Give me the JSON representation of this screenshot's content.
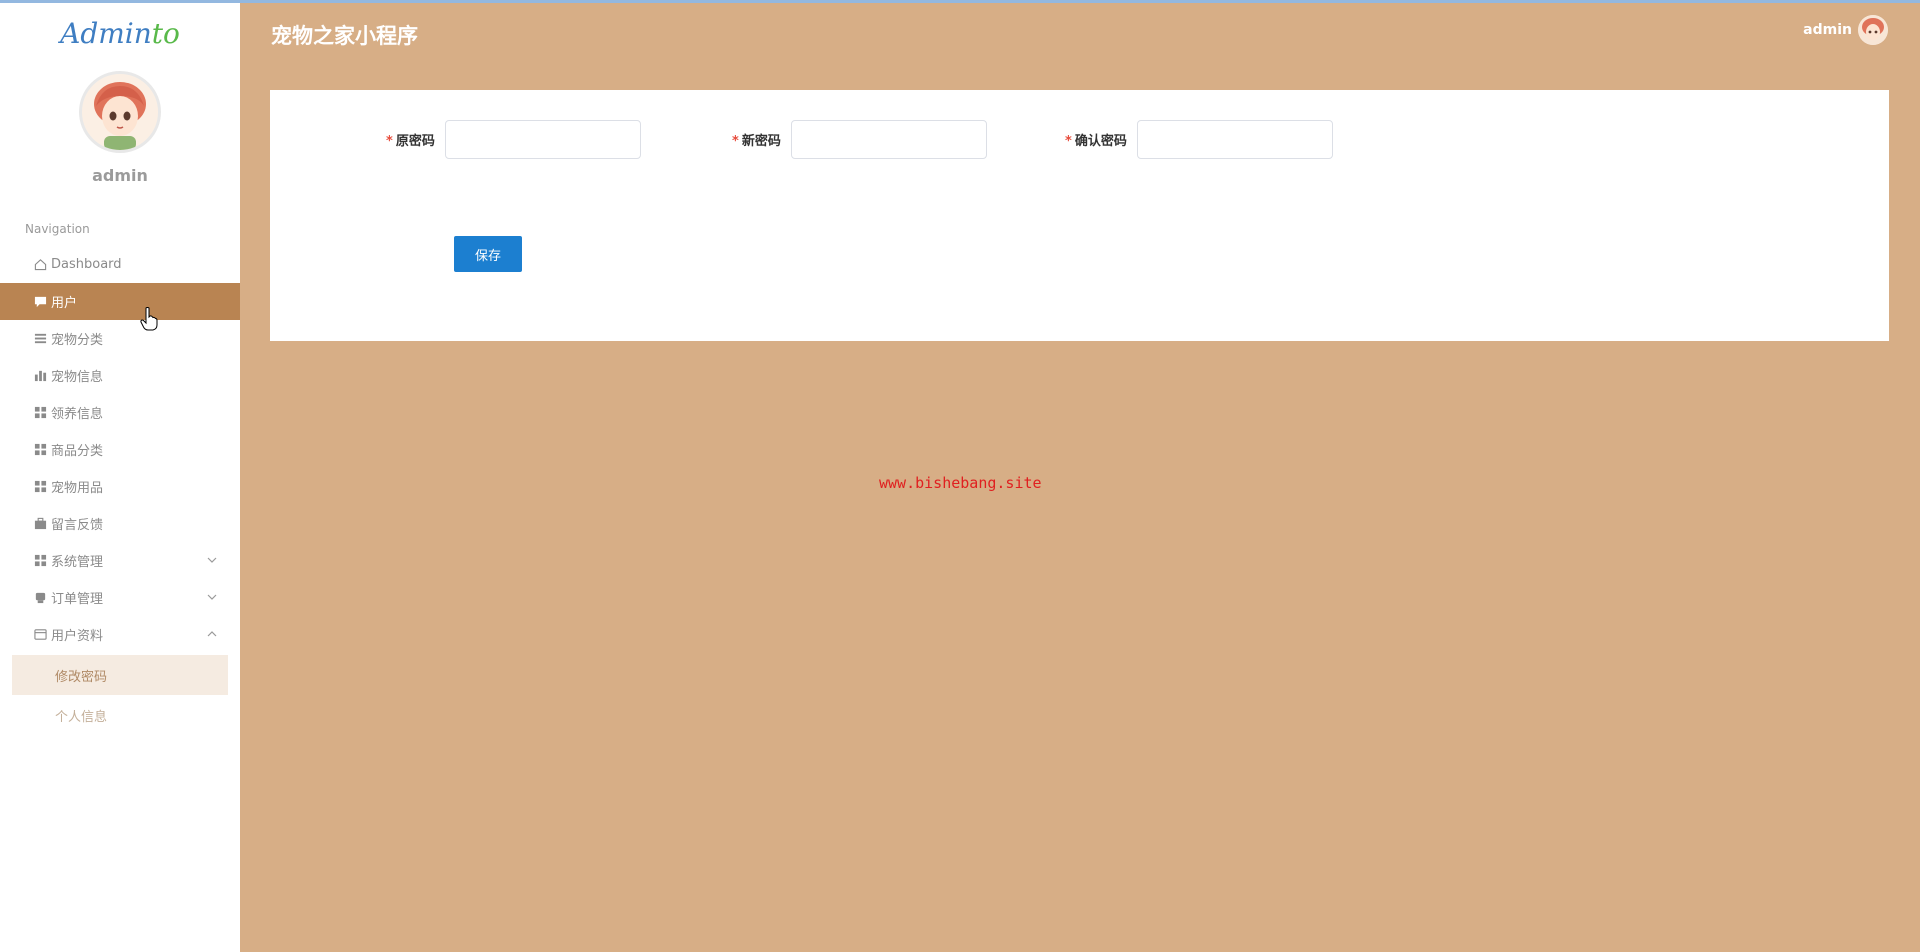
{
  "colors": {
    "accent": "#b98452",
    "background": "#d7ae86",
    "primary_button": "#1c7fd0",
    "logo_blue": "#3f7ec2",
    "logo_green": "#59b94a"
  },
  "sidebar": {
    "logo_main": "Admin",
    "logo_accent": "to",
    "profile_name": "admin",
    "nav_title": "Navigation",
    "items": [
      {
        "label": "Dashboard",
        "icon": "home-icon"
      },
      {
        "label": "用户",
        "icon": "chat-icon",
        "active": true
      },
      {
        "label": "宠物分类",
        "icon": "list-icon"
      },
      {
        "label": "宠物信息",
        "icon": "bar-chart-icon"
      },
      {
        "label": "领养信息",
        "icon": "grid-icon"
      },
      {
        "label": "商品分类",
        "icon": "grid-icon"
      },
      {
        "label": "宠物用品",
        "icon": "grid-icon"
      },
      {
        "label": "留言反馈",
        "icon": "briefcase-icon"
      },
      {
        "label": "系统管理",
        "icon": "grid-icon",
        "chevron": "down"
      },
      {
        "label": "订单管理",
        "icon": "printer-icon",
        "chevron": "down"
      },
      {
        "label": "用户资料",
        "icon": "wallet-icon",
        "chevron": "up"
      }
    ],
    "sub_items": [
      {
        "label": "修改密码",
        "active": true
      },
      {
        "label": "个人信息"
      }
    ]
  },
  "header": {
    "title": "宠物之家小程序",
    "user_name": "admin"
  },
  "form": {
    "old_password_label": "原密码",
    "new_password_label": "新密码",
    "confirm_password_label": "确认密码",
    "required_mark": "*",
    "old_password_value": "",
    "new_password_value": "",
    "confirm_password_value": "",
    "save_label": "保存"
  },
  "watermark": "www.bishebang.site"
}
